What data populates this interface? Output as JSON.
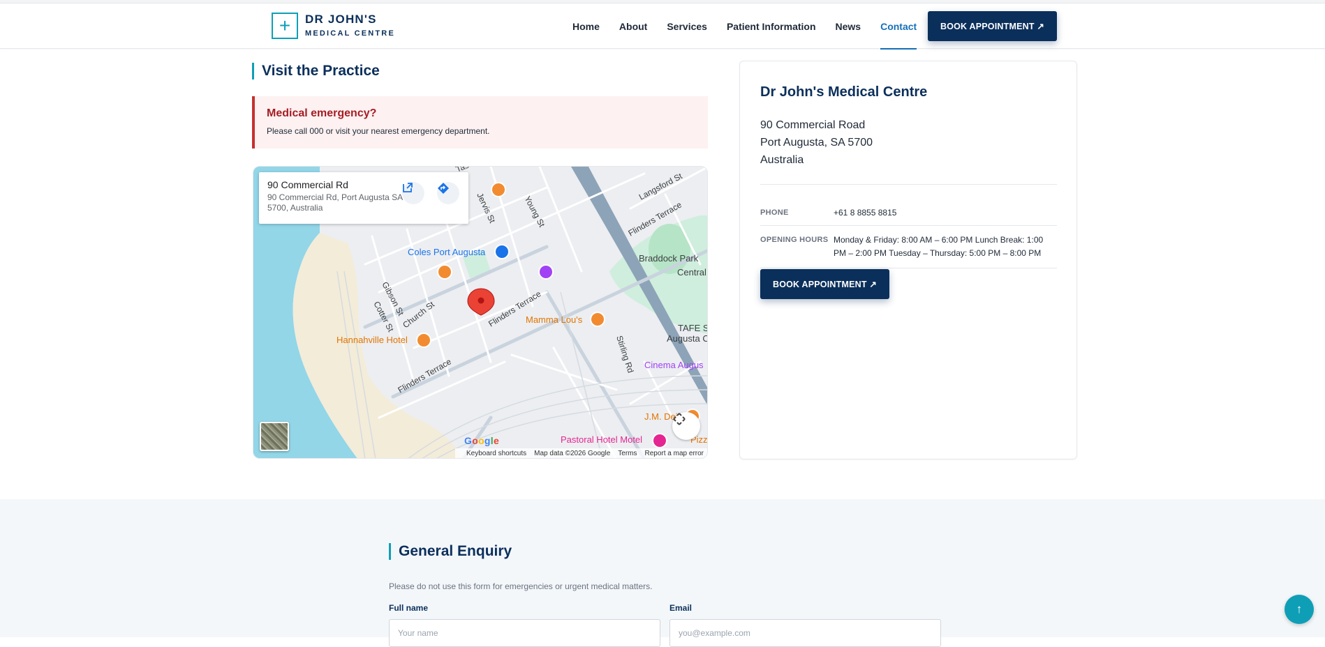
{
  "brand": {
    "name": "DR JOHN'S",
    "subtitle": "MEDICAL CENTRE",
    "logo_symbol": "+",
    "accent_color": "#0e9fb7",
    "primary_color": "#0b2f5b"
  },
  "nav": {
    "items": [
      {
        "label": "Home",
        "active": false
      },
      {
        "label": "About",
        "active": false
      },
      {
        "label": "Services",
        "active": false
      },
      {
        "label": "Patient Information",
        "active": false
      },
      {
        "label": "News",
        "active": false
      },
      {
        "label": "Contact",
        "active": true
      }
    ],
    "cta_label": "BOOK APPOINTMENT ↗"
  },
  "visit": {
    "title": "Visit the Practice",
    "emergency_title": "Medical emergency?",
    "emergency_text": "Please call 000 or visit your nearest emergency department."
  },
  "map": {
    "place_title": "90 Commercial Rd",
    "place_address": "90 Commercial Rd, Port Augusta SA 5700, Australia",
    "labels": {
      "coles": "Coles Port Augusta",
      "braddock": "Braddock Park",
      "central": "Central",
      "mamma": "Mamma Lou's",
      "hannahville": "Hannahville Hotel",
      "tafe1": "TAFE S",
      "tafe2": "Augusta C",
      "cinema": "Cinema Augus",
      "jm": "J.M. Dei",
      "pastoral": "Pastoral Hotel Motel",
      "pizza": "Pizz",
      "langsford": "Langsford St",
      "flinders1": "Flinders Terrace",
      "flinders2": "Flinders Terrace",
      "flinders3": "Flinders Terrace",
      "young": "Young St",
      "gibson": "Gibson St",
      "church": "Church St",
      "cotter": "Cotter St",
      "stirling": "Stirling Rd",
      "jervis": "Jervis St",
      "tas": "Tas"
    },
    "google": "Google",
    "footer": [
      "Keyboard shortcuts",
      "Map data ©2026 Google",
      "Terms",
      "Report a map error"
    ]
  },
  "contact": {
    "name": "Dr John's Medical Centre",
    "address_line1": "90 Commercial Road",
    "address_line2": "Port Augusta, SA 5700",
    "address_line3": "Australia",
    "phone_label": "PHONE",
    "phone": "+61 8 8855 8815",
    "hours_label": "OPENING HOURS",
    "hours": "Monday & Friday: 8:00 AM – 6:00 PM Lunch Break: 1:00 PM – 2:00 PM Tuesday – Thursday: 5:00 PM – 8:00 PM",
    "cta_label": "BOOK APPOINTMENT ↗"
  },
  "enquiry": {
    "title": "General Enquiry",
    "subtitle": "Please do not use this form for emergencies or urgent medical matters.",
    "name_label": "Full name",
    "name_placeholder": "Your name",
    "email_label": "Email",
    "email_placeholder": "you@example.com"
  },
  "back_to_top": "↑"
}
